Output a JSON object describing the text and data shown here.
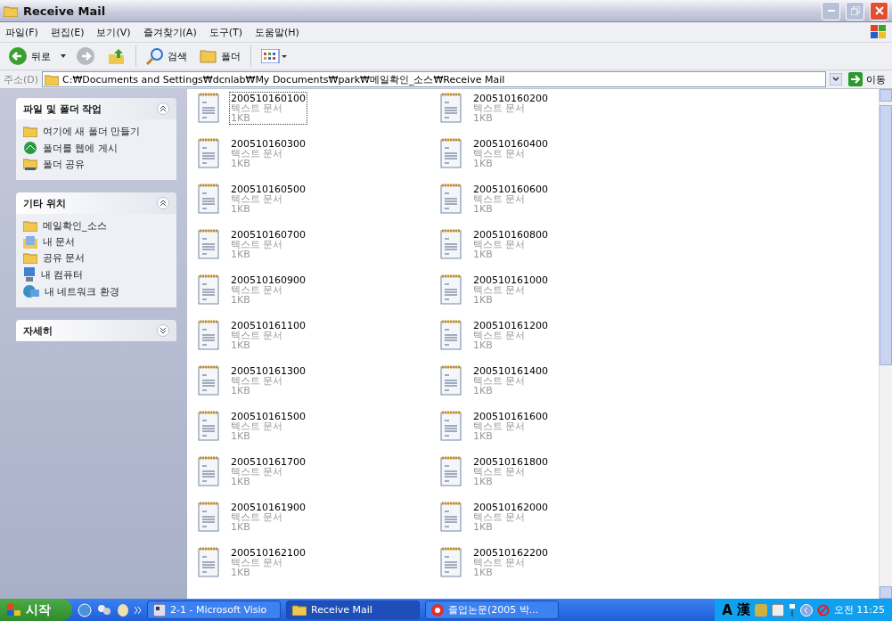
{
  "window": {
    "title": "Receive Mail"
  },
  "menu": [
    "파일(F)",
    "편집(E)",
    "보기(V)",
    "즐겨찾기(A)",
    "도구(T)",
    "도움말(H)"
  ],
  "toolbar": {
    "back": "뒤로",
    "search": "검색",
    "folders": "폴더"
  },
  "address": {
    "label": "주소(D)",
    "value": "C:₩Documents and Settings₩dcnlab₩My Documents₩park₩메일확인_소스₩Receive Mail",
    "go": "이동"
  },
  "sidebar": [
    {
      "title": "파일 및 폴더 작업",
      "expanded": true,
      "items": [
        {
          "label": "여기에 새 폴더 만들기",
          "kind": "newfolder"
        },
        {
          "label": "폴더를 웹에 게시",
          "kind": "web"
        },
        {
          "label": "폴더 공유",
          "kind": "share"
        }
      ]
    },
    {
      "title": "기타 위치",
      "expanded": true,
      "items": [
        {
          "label": "메일확인_소스",
          "kind": "folder"
        },
        {
          "label": "내 문서",
          "kind": "docs"
        },
        {
          "label": "공유 문서",
          "kind": "folder"
        },
        {
          "label": "내 컴퓨터",
          "kind": "computer"
        },
        {
          "label": "내 네트워크 환경",
          "kind": "network"
        }
      ]
    },
    {
      "title": "자세히",
      "expanded": false
    }
  ],
  "files": [
    {
      "name": "200510160100",
      "type": "텍스트 문서",
      "size": "1KB",
      "selected": true
    },
    {
      "name": "200510160200",
      "type": "텍스트 문서",
      "size": "1KB",
      "selected": false
    },
    {
      "name": "200510160300",
      "type": "텍스트 문서",
      "size": "1KB",
      "selected": false
    },
    {
      "name": "200510160400",
      "type": "텍스트 문서",
      "size": "1KB",
      "selected": false
    },
    {
      "name": "200510160500",
      "type": "텍스트 문서",
      "size": "1KB",
      "selected": false
    },
    {
      "name": "200510160600",
      "type": "텍스트 문서",
      "size": "1KB",
      "selected": false
    },
    {
      "name": "200510160700",
      "type": "텍스트 문서",
      "size": "1KB",
      "selected": false
    },
    {
      "name": "200510160800",
      "type": "텍스트 문서",
      "size": "1KB",
      "selected": false
    },
    {
      "name": "200510160900",
      "type": "텍스트 문서",
      "size": "1KB",
      "selected": false
    },
    {
      "name": "200510161000",
      "type": "텍스트 문서",
      "size": "1KB",
      "selected": false
    },
    {
      "name": "200510161100",
      "type": "텍스트 문서",
      "size": "1KB",
      "selected": false
    },
    {
      "name": "200510161200",
      "type": "텍스트 문서",
      "size": "1KB",
      "selected": false
    },
    {
      "name": "200510161300",
      "type": "텍스트 문서",
      "size": "1KB",
      "selected": false
    },
    {
      "name": "200510161400",
      "type": "텍스트 문서",
      "size": "1KB",
      "selected": false
    },
    {
      "name": "200510161500",
      "type": "텍스트 문서",
      "size": "1KB",
      "selected": false
    },
    {
      "name": "200510161600",
      "type": "텍스트 문서",
      "size": "1KB",
      "selected": false
    },
    {
      "name": "200510161700",
      "type": "텍스트 문서",
      "size": "1KB",
      "selected": false
    },
    {
      "name": "200510161800",
      "type": "텍스트 문서",
      "size": "1KB",
      "selected": false
    },
    {
      "name": "200510161900",
      "type": "텍스트 문서",
      "size": "1KB",
      "selected": false
    },
    {
      "name": "200510162000",
      "type": "텍스트 문서",
      "size": "1KB",
      "selected": false
    },
    {
      "name": "200510162100",
      "type": "텍스트 문서",
      "size": "1KB",
      "selected": false
    },
    {
      "name": "200510162200",
      "type": "텍스트 문서",
      "size": "1KB",
      "selected": false
    }
  ],
  "taskbar": {
    "start": "시작",
    "tasks": [
      {
        "label": "2-1 - Microsoft Visio",
        "kind": "visio",
        "selected": false
      },
      {
        "label": "Receive Mail",
        "kind": "folder",
        "selected": true
      },
      {
        "label": "졸업논문(2005 박...",
        "kind": "doc",
        "selected": false
      }
    ],
    "tray": {
      "ime_a": "A",
      "ime_han": "漢",
      "clock": "오전 11:25"
    }
  }
}
